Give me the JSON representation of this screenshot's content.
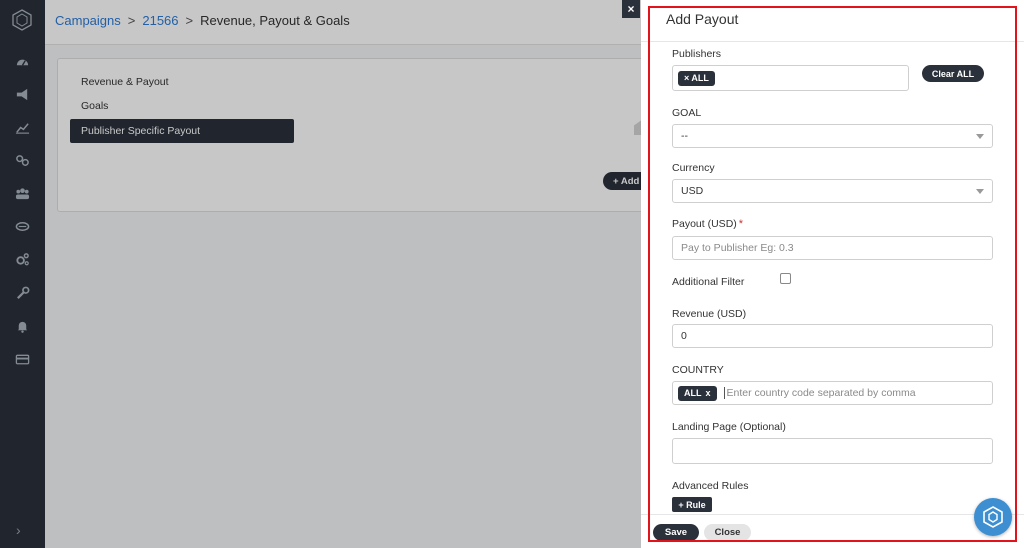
{
  "breadcrumb": {
    "campaigns": "Campaigns",
    "sep1": ">",
    "campaign_id": "21566",
    "sep2": ">",
    "current": "Revenue, Payout & Goals"
  },
  "sidebar": {
    "icons": [
      "dashboard-icon",
      "megaphone-icon",
      "chart-icon",
      "link-icon",
      "users-icon",
      "handshake-icon",
      "cogs-icon",
      "wrench-icon",
      "bell-icon",
      "credit-card-icon"
    ],
    "expand_label": "›"
  },
  "section_nav": {
    "items": [
      {
        "label": "Revenue & Payout",
        "active": false
      },
      {
        "label": "Goals",
        "active": false
      },
      {
        "label": "Publisher Specific Payout",
        "active": true
      }
    ]
  },
  "base": {
    "add_label": "+ Add"
  },
  "drawer": {
    "close_label": "×",
    "title": "Add Payout",
    "publishers": {
      "label": "Publishers",
      "chip": "× ALL",
      "clear_label": "Clear ALL"
    },
    "goal": {
      "label": "GOAL",
      "value": "--"
    },
    "currency": {
      "label": "Currency",
      "value": "USD"
    },
    "payout": {
      "label": "Payout (USD)",
      "required_mark": "*",
      "placeholder": "Pay to Publisher Eg: 0.3"
    },
    "additional_filter": {
      "label": "Additional Filter",
      "checked": false
    },
    "revenue": {
      "label": "Revenue (USD)",
      "value": "0"
    },
    "country": {
      "label": "COUNTRY",
      "chip": "ALL",
      "chip_remove": "x",
      "placeholder": "Enter country code separated by comma"
    },
    "landing_page": {
      "label": "Landing Page (Optional)",
      "value": ""
    },
    "advanced_rules": {
      "label": "Advanced Rules",
      "rule_button": "+ Rule"
    },
    "save_label": "Save",
    "cancel_label": "Close"
  },
  "colors": {
    "dark": "#2b313b",
    "link": "#2e7cd4",
    "required": "#d0312d",
    "highlight": "#e3131b",
    "fab": "#3d8fd1"
  }
}
